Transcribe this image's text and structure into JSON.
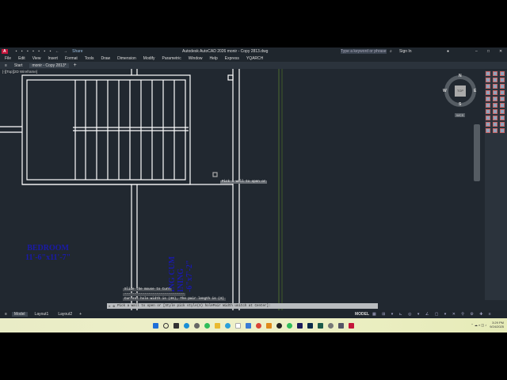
{
  "app": {
    "logo": "A",
    "share": "Share",
    "title": "Autodesk AutoCAD 2026    monir - Copy 2813.dwg",
    "search_placeholder": "Type a keyword or phrase",
    "sign_in": "Sign In"
  },
  "menu": [
    "File",
    "Edit",
    "View",
    "Insert",
    "Format",
    "Tools",
    "Draw",
    "Dimension",
    "Modify",
    "Parametric",
    "Window",
    "Help",
    "Express",
    "YQARCH"
  ],
  "tabs": {
    "start": "Start",
    "doc": "monir - Copy 2813*",
    "add": "+"
  },
  "viewport": {
    "label": "[-][Top][2D Wireframe]",
    "compass": {
      "n": "N",
      "s": "S",
      "e": "E",
      "w": "W",
      "top": "TOP",
      "wcs": "WCS"
    },
    "tooltip": "Pick a wall to open or"
  },
  "drawing": {
    "room1_name": "BEDROOM",
    "room1_size": "11'-6\"x11'-7\"",
    "room2_line1": "ING CUM",
    "room2_line2": "INING",
    "room2_size": "-6\"x7'-2\""
  },
  "command": {
    "history": [
      "Slide the mouse to turn",
      "------------------------------",
      "Current hole width is (36), The pair length is (3)"
    ],
    "prompt": "Pick a wall to open or [Style pick style(X) holePair Width unitch at Center]:"
  },
  "layout_tabs": [
    "Model",
    "Layout1",
    "Layout2"
  ],
  "status": {
    "model": "MODEL"
  },
  "clock": {
    "time": "3:29 PM",
    "date": "9/24/2025"
  },
  "colors": {
    "accent": "#c4163b",
    "room_text": "#1a1aa8",
    "bg": "#212830"
  }
}
